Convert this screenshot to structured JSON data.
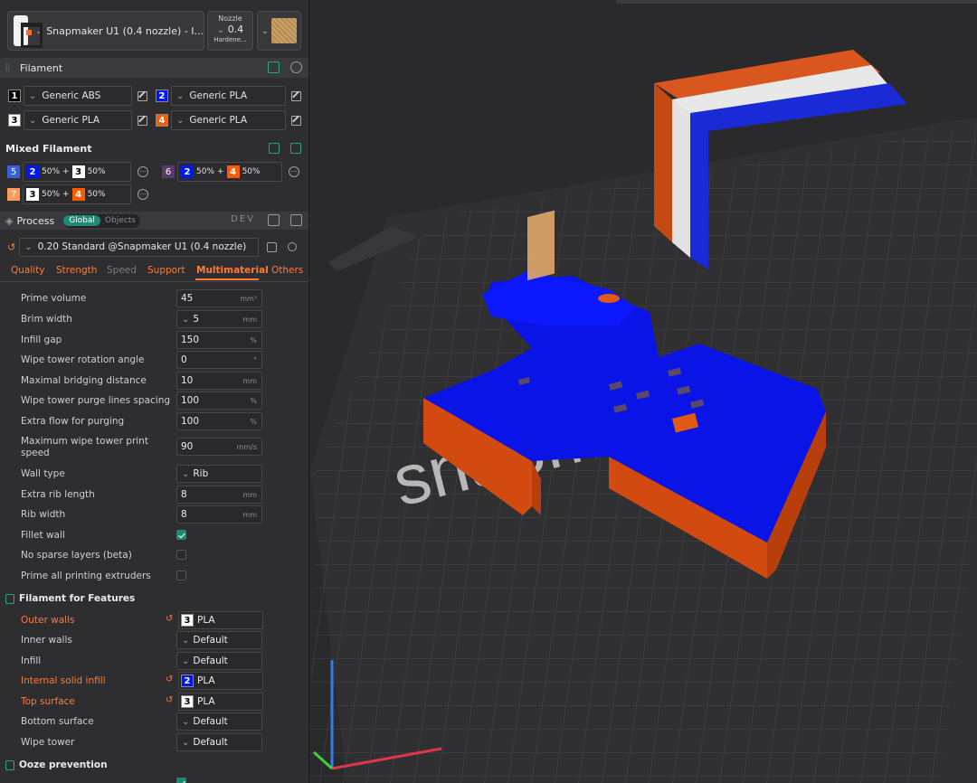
{
  "printer": {
    "name": "Snapmaker U1 (0.4 nozzle) - I...",
    "nozzle_label": "Nozzle",
    "nozzle_value": "0.4",
    "nozzle_type": "Hardene..."
  },
  "filament": {
    "title": "Filament",
    "slots": [
      {
        "id": "1",
        "name": "Generic ABS",
        "color": "#000000",
        "text": "#ffffff"
      },
      {
        "id": "2",
        "name": "Generic PLA",
        "color": "#0015ff",
        "text": "#ffffff"
      },
      {
        "id": "3",
        "name": "Generic PLA",
        "color": "#ffffff",
        "text": "#000000"
      },
      {
        "id": "4",
        "name": "Generic PLA",
        "color": "#ff5a00",
        "text": "#ffffff"
      }
    ]
  },
  "mixed": {
    "title": "Mixed Filament",
    "items": [
      {
        "id": "5",
        "id_color": "#3a5fd6",
        "a": "2",
        "a_pct": "50%",
        "b": "3",
        "b_pct": "50%"
      },
      {
        "id": "6",
        "id_color": "#5a3a6a",
        "a": "2",
        "a_pct": "50%",
        "b": "4",
        "b_pct": "50%"
      },
      {
        "id": "7",
        "id_color": "#ff9a5a",
        "a": "3",
        "a_pct": "50%",
        "b": "4",
        "b_pct": "50%"
      }
    ],
    "plus": "+"
  },
  "process": {
    "title": "Process",
    "global": "Global",
    "objects": "Objects",
    "dev": "DEV",
    "preset": "0.20 Standard @Snapmaker U1 (0.4 nozzle)"
  },
  "tabs": [
    "Quality",
    "Strength",
    "Speed",
    "Support",
    "Multimaterial",
    "Others"
  ],
  "params": {
    "prime_volume": {
      "label": "Prime volume",
      "value": "45",
      "unit": "mm³"
    },
    "brim_width": {
      "label": "Brim width",
      "value": "5",
      "unit": "mm"
    },
    "infill_gap": {
      "label": "Infill gap",
      "value": "150",
      "unit": "%"
    },
    "rotation": {
      "label": "Wipe tower rotation angle",
      "value": "0",
      "unit": "°"
    },
    "bridging": {
      "label": "Maximal bridging distance",
      "value": "10",
      "unit": "mm"
    },
    "purge_spacing": {
      "label": "Wipe tower purge lines spacing",
      "value": "100",
      "unit": "%"
    },
    "extra_flow": {
      "label": "Extra flow for purging",
      "value": "100",
      "unit": "%"
    },
    "max_speed_1": "Maximum wipe tower print",
    "max_speed_2": "speed",
    "max_speed": {
      "value": "90",
      "unit": "mm/s"
    },
    "wall_type": {
      "label": "Wall type",
      "value": "Rib"
    },
    "rib_length": {
      "label": "Extra rib length",
      "value": "8",
      "unit": "mm"
    },
    "rib_width": {
      "label": "Rib width",
      "value": "8",
      "unit": "mm"
    },
    "fillet_wall": "Fillet wall",
    "no_sparse": "No sparse layers (beta)",
    "prime_all": "Prime all printing extruders"
  },
  "features": {
    "title": "Filament for Features",
    "rows": [
      {
        "label": "Outer walls",
        "badge": "3",
        "value": "PLA"
      },
      {
        "label": "Inner walls",
        "value": "Default"
      },
      {
        "label": "Infill",
        "value": "Default"
      },
      {
        "label": "Internal solid infill",
        "badge": "2",
        "value": "PLA"
      },
      {
        "label": "Top surface",
        "badge": "3",
        "value": "PLA"
      },
      {
        "label": "Bottom surface",
        "value": "Default"
      },
      {
        "label": "Wipe tower",
        "value": "Default"
      }
    ]
  },
  "ooze": {
    "title": "Ooze prevention"
  },
  "scene": {
    "bed_text": "snapmaker",
    "model_color": "#0a14e6",
    "model_side": "#d24a10",
    "tower_colors": [
      "#d9571e",
      "#e8e8e8",
      "#1a2ad6"
    ]
  }
}
